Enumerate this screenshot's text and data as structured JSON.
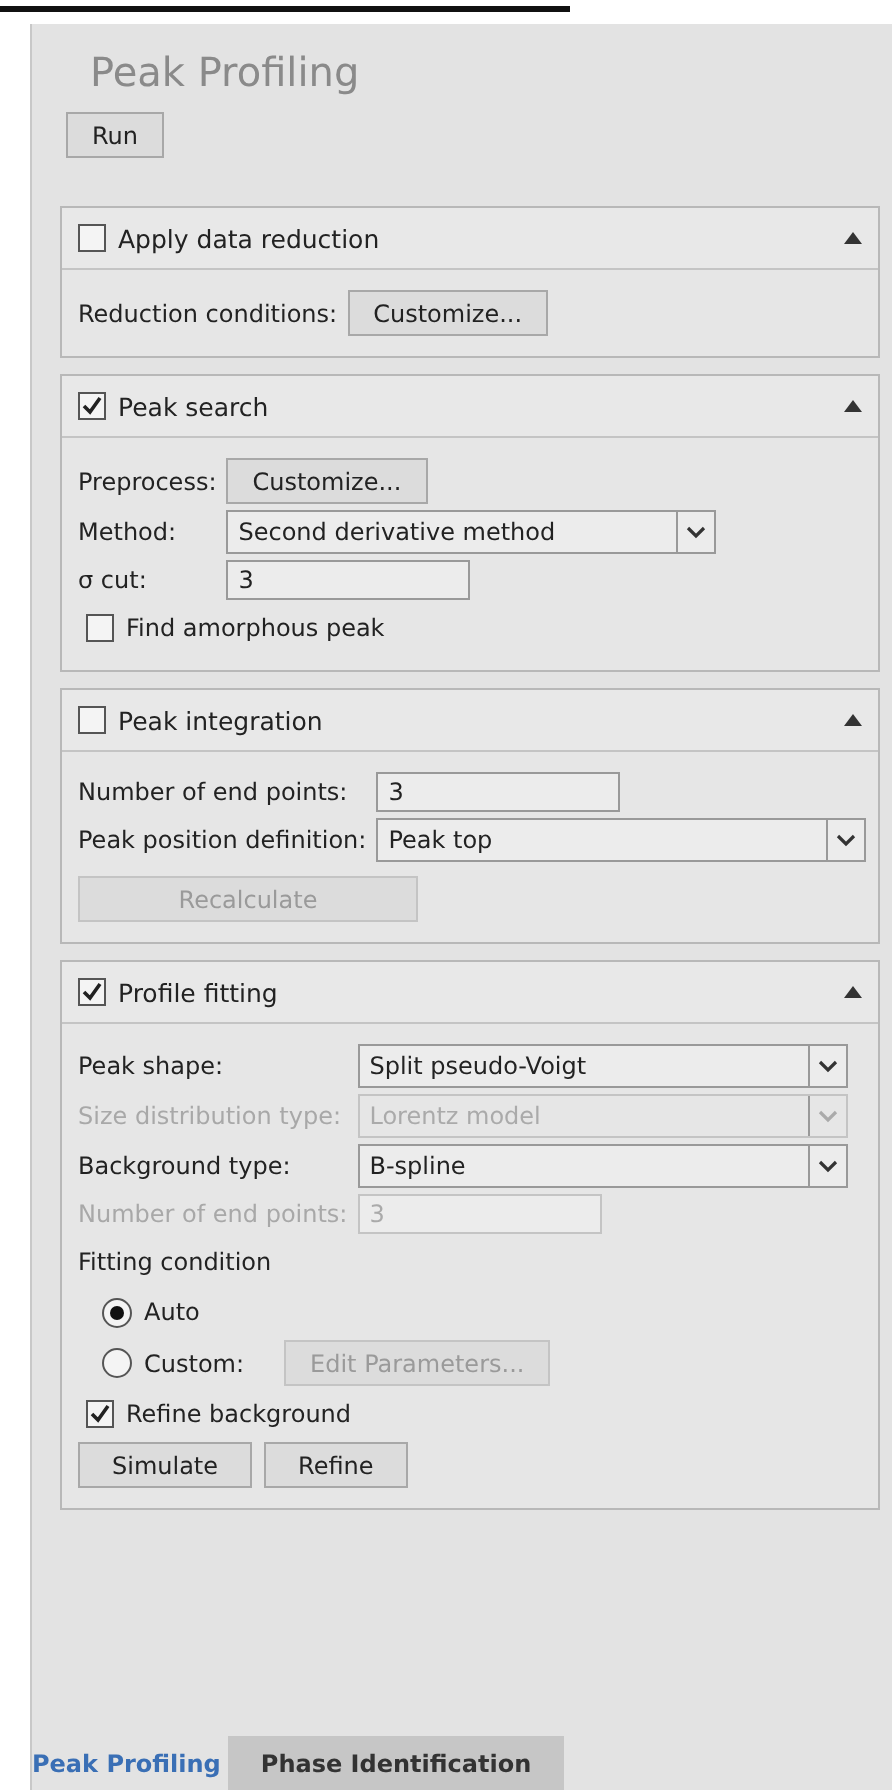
{
  "title": "Peak Profiling",
  "run_button": "Run",
  "sections": [
    {
      "label": "Apply data reduction",
      "checked": false,
      "expanded": true,
      "rows": [
        {
          "kind": "button",
          "label": "Reduction conditions:",
          "button": "Customize...",
          "disabled": false
        }
      ]
    },
    {
      "label": "Peak search",
      "checked": true,
      "expanded": true,
      "rows": [
        {
          "kind": "button",
          "label": "Preprocess:",
          "button": "Customize...",
          "disabled": false
        },
        {
          "kind": "select",
          "label": "Method:",
          "value": "Second derivative method",
          "disabled": false
        },
        {
          "kind": "text",
          "label": "σ cut:",
          "value": "3",
          "disabled": false
        },
        {
          "kind": "checkbox",
          "label": "Find amorphous peak",
          "checked": false
        }
      ]
    },
    {
      "label": "Peak integration",
      "checked": false,
      "expanded": true,
      "rows": [
        {
          "kind": "text",
          "label": "Number of end points:",
          "value": "3",
          "disabled": false
        },
        {
          "kind": "select",
          "label": "Peak position definition:",
          "value": "Peak top",
          "disabled": false
        },
        {
          "kind": "action",
          "button": "Recalculate",
          "disabled": true
        }
      ]
    },
    {
      "label": "Profile fitting",
      "checked": true,
      "expanded": true,
      "rows": [
        {
          "kind": "select",
          "label": "Peak shape:",
          "value": "Split pseudo-Voigt",
          "disabled": false
        },
        {
          "kind": "select",
          "label": "Size distribution type:",
          "value": "Lorentz model",
          "disabled": true
        },
        {
          "kind": "select",
          "label": "Background type:",
          "value": "B-spline",
          "disabled": false
        },
        {
          "kind": "text",
          "label": "Number of end points:",
          "value": "3",
          "disabled": true
        },
        {
          "kind": "heading",
          "label": "Fitting condition"
        },
        {
          "kind": "radio",
          "label": "Auto",
          "selected": true
        },
        {
          "kind": "radio",
          "label": "Custom:",
          "selected": false,
          "button": "Edit Parameters...",
          "disabled": true
        },
        {
          "kind": "checkbox",
          "label": "Refine background",
          "checked": true
        },
        {
          "kind": "actions",
          "buttons": [
            "Simulate",
            "Refine"
          ]
        }
      ]
    }
  ],
  "tabs": [
    {
      "label": "Peak Profiling",
      "selected": true
    },
    {
      "label": "Phase Identification",
      "selected": false
    }
  ]
}
